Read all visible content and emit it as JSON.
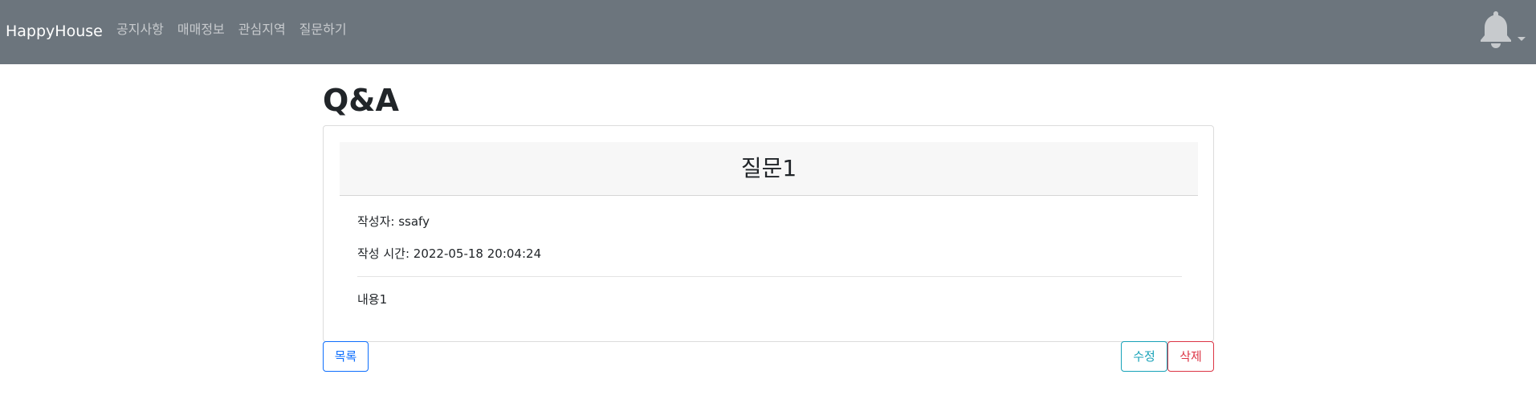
{
  "navbar": {
    "brand": "HappyHouse",
    "links": [
      {
        "label": "공지사항"
      },
      {
        "label": "매매정보"
      },
      {
        "label": "관심지역"
      },
      {
        "label": "질문하기"
      }
    ],
    "notification_icon": "bell-icon",
    "dropdown_icon": "caret-down-icon",
    "background": "#6c757d"
  },
  "page": {
    "title": "Q&A"
  },
  "question": {
    "title": "질문1",
    "author_label": "작성자: ",
    "author": "ssafy",
    "time_label": "작성 시간: ",
    "time": "2022-05-18 20:04:24",
    "content": "내용1"
  },
  "actions": {
    "list_label": "목록",
    "edit_label": "수정",
    "delete_label": "삭제"
  },
  "colors": {
    "primary": "#0d6efd",
    "info": "#17a2b8",
    "danger": "#dc3545"
  }
}
